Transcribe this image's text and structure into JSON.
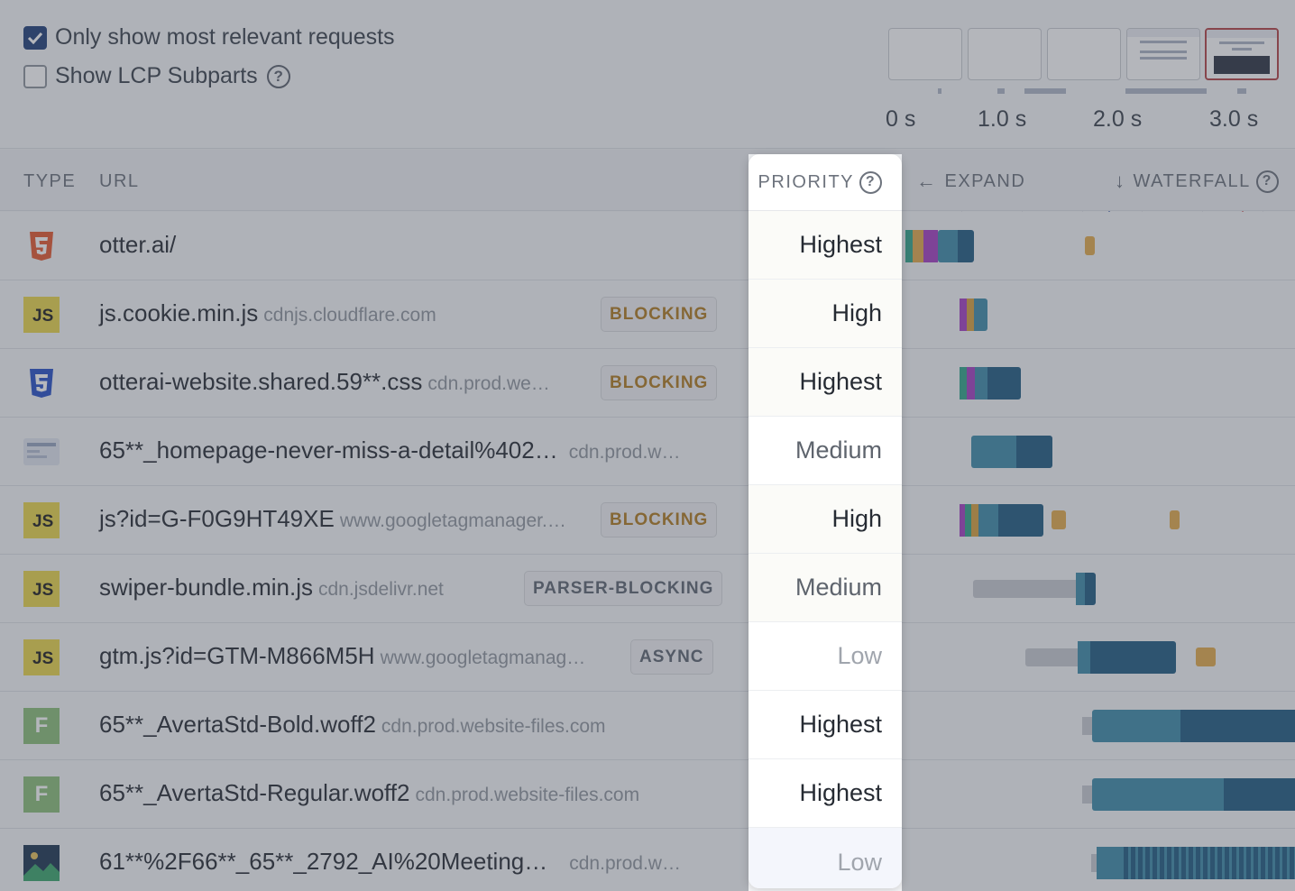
{
  "options": {
    "relevant_label": "Only show most relevant requests",
    "lcp_label": "Show LCP Subparts",
    "help_glyph": "?"
  },
  "timeline": {
    "labels": [
      "0 s",
      "1.0 s",
      "2.0 s",
      "3.0 s"
    ]
  },
  "columns": {
    "type": "TYPE",
    "url": "URL",
    "priority": "PRIORITY",
    "expand": "EXPAND",
    "waterfall": "WATERFALL"
  },
  "rows": [
    {
      "type": "html",
      "url": "otter.ai/",
      "host": "",
      "badge": "",
      "priority": "Highest"
    },
    {
      "type": "js",
      "url": "js.cookie.min.js",
      "host": "cdnjs.cloudflare.com",
      "badge": "BLOCKING",
      "priority": "High"
    },
    {
      "type": "css",
      "url": "otterai-website.shared.59**.css",
      "host": "cdn.prod.we…",
      "badge": "BLOCKING",
      "priority": "Highest"
    },
    {
      "type": "image",
      "url": "65**_homepage-never-miss-a-detail%402…",
      "host": "cdn.prod.w…",
      "badge": "",
      "priority": "Medium"
    },
    {
      "type": "js",
      "url": "js?id=G-F0G9HT49XE",
      "host": "www.googletagmanager.…",
      "badge": "BLOCKING",
      "priority": "High"
    },
    {
      "type": "js",
      "url": "swiper-bundle.min.js",
      "host": "cdn.jsdelivr.net",
      "badge": "PARSER-BLOCKING",
      "priority": "Medium"
    },
    {
      "type": "js",
      "url": "gtm.js?id=GTM-M866M5H",
      "host": "www.googletagmanag…",
      "badge": "ASYNC",
      "priority": "Low"
    },
    {
      "type": "font",
      "url": "65**_AvertaStd-Bold.woff2",
      "host": "cdn.prod.website-files.com",
      "badge": "",
      "priority": "Highest"
    },
    {
      "type": "font",
      "url": "65**_AvertaStd-Regular.woff2",
      "host": "cdn.prod.website-files.com",
      "badge": "",
      "priority": "Highest"
    },
    {
      "type": "image",
      "url": "61**%2F66**_65**_2792_AI%20Meeting…",
      "host": "cdn.prod.w…",
      "badge": "",
      "priority": "Low"
    }
  ],
  "icons": {
    "js_text": "JS",
    "font_text": "F"
  },
  "colors": {
    "accent": "#1f3f78",
    "lcp_line": "#b34245",
    "blocking": "#b07a1f"
  }
}
